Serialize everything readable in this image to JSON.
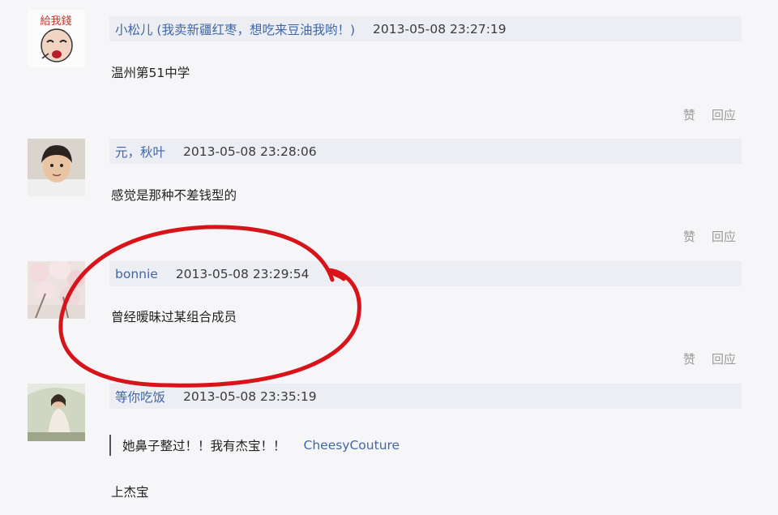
{
  "comments": [
    {
      "author": "小松儿 (我卖新疆红枣，想吃来豆油我哟！)",
      "time": "2013-05-08 23:27:19",
      "content": "温州第51中学",
      "actions": {
        "like": "赞",
        "reply": "回应"
      },
      "avatar_icon": "cartoon-face-avatar",
      "avatar_text": "給我錢"
    },
    {
      "author": "元，秋叶",
      "time": "2013-05-08 23:28:06",
      "content": "感觉是那种不差钱型的",
      "actions": {
        "like": "赞",
        "reply": "回应"
      },
      "avatar_icon": "child-photo-avatar"
    },
    {
      "author": "bonnie",
      "time": "2013-05-08 23:29:54",
      "content": "曾经暧昧过某组合成员",
      "actions": {
        "like": "赞",
        "reply": "回应"
      },
      "avatar_icon": "blossom-photo-avatar"
    },
    {
      "author": "等你吃饭",
      "time": "2013-05-08 23:35:19",
      "quote": {
        "text": "她鼻子整过！！我有杰宝！！",
        "author": "CheesyCouture"
      },
      "content": "上杰宝",
      "avatar_icon": "girl-photo-avatar"
    }
  ],
  "colors": {
    "link": "#3f67a8",
    "meta_bar_bg": "#eceef3",
    "highlight_ring": "#d8141a",
    "background": "#f6f6f8"
  }
}
